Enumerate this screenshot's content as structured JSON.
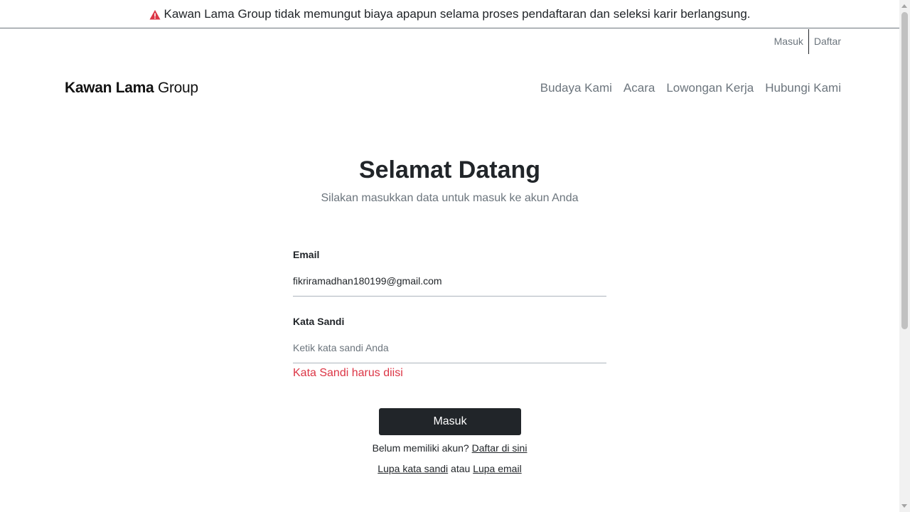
{
  "notice": {
    "text": "Kawan Lama Group tidak memungut biaya apapun selama proses pendaftaran dan seleksi karir berlangsung.",
    "icon": "warning-icon",
    "icon_color": "#dc3545"
  },
  "auth_links": {
    "login": "Masuk",
    "register": "Daftar"
  },
  "header": {
    "logo_bold": "Kawan Lama",
    "logo_light": "Group",
    "nav": [
      {
        "label": "Budaya Kami"
      },
      {
        "label": "Acara"
      },
      {
        "label": "Lowongan Kerja"
      },
      {
        "label": "Hubungi Kami"
      }
    ]
  },
  "login": {
    "title": "Selamat Datang",
    "subtitle": "Silakan masukkan data untuk masuk ke akun Anda",
    "email_label": "Email",
    "email_value": "fikriramadhan180199@gmail.com",
    "password_label": "Kata Sandi",
    "password_placeholder": "Ketik kata sandi Anda",
    "password_value": "",
    "password_error": "Kata Sandi harus diisi",
    "submit_label": "Masuk",
    "register_prompt": "Belum memiliki akun?",
    "register_link": "Daftar di sini",
    "forgot_password_link": "Lupa kata sandi",
    "or_text": "atau",
    "forgot_email_link": "Lupa email"
  },
  "colors": {
    "primary_dark": "#212529",
    "muted": "#6c757d",
    "error": "#dc3545"
  }
}
